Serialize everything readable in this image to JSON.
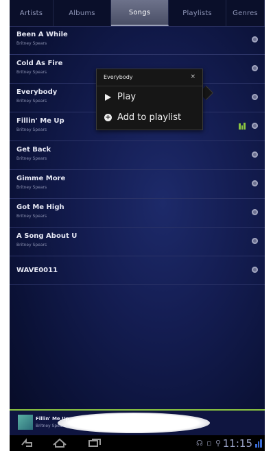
{
  "tabs": [
    "Artists",
    "Albums",
    "Songs",
    "Playlists",
    "Genres"
  ],
  "active_tab": "Songs",
  "songs": [
    {
      "title": "Been A While",
      "artist": "Britney Spears"
    },
    {
      "title": "Cold As Fire",
      "artist": "Britney Spears"
    },
    {
      "title": "Everybody",
      "artist": "Britney Spears"
    },
    {
      "title": "Fillin' Me Up",
      "artist": "Britney Spears"
    },
    {
      "title": "Get Back",
      "artist": "Britney Spears"
    },
    {
      "title": "Gimme More",
      "artist": "Britney Spears"
    },
    {
      "title": "Got Me High",
      "artist": "Britney Spears"
    },
    {
      "title": "A Song About U",
      "artist": "Britney Spears"
    },
    {
      "title": "WAVE0011",
      "artist": ""
    }
  ],
  "context_menu": {
    "title": "Everybody",
    "close": "×",
    "items": [
      "Play",
      "Add to playlist"
    ]
  },
  "now_playing": {
    "title": "Fillin' Me Up",
    "artist": "Britney Spears"
  },
  "status": {
    "time": "11:15"
  },
  "colors": {
    "accent": "#8bc540",
    "background": "#141d52"
  },
  "icons": {
    "nav": [
      "back-icon",
      "home-icon",
      "recent-apps-icon"
    ],
    "row_action": "more-options-icon",
    "now_playing": "equalizer-icon"
  }
}
